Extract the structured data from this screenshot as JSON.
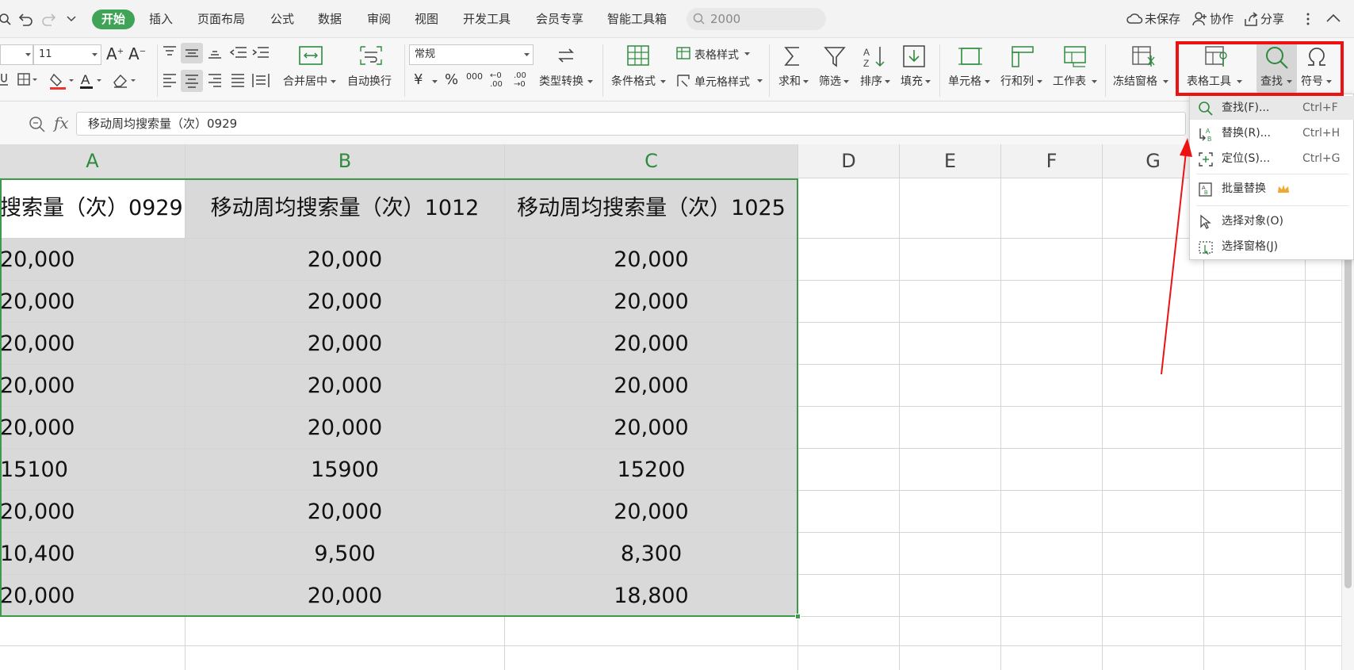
{
  "menubar": {
    "tabs": [
      "开始",
      "插入",
      "页面布局",
      "公式",
      "数据",
      "审阅",
      "视图",
      "开发工具",
      "会员专享",
      "智能工具箱"
    ],
    "active_tab": "开始",
    "search_value": "2000",
    "unsaved_label": "未保存",
    "collab_label": "协作",
    "share_label": "分享"
  },
  "ribbon": {
    "font_size": "11",
    "number_format": "常规",
    "merge_label": "合并居中",
    "wrap_label": "自动换行",
    "type_convert_label": "类型转换",
    "cond_format_label": "条件格式",
    "table_style_label": "表格样式",
    "cell_style_label": "单元格样式",
    "sum_label": "求和",
    "filter_label": "筛选",
    "sort_label": "排序",
    "fill_label": "填充",
    "cell_label": "单元格",
    "rowcol_label": "行和列",
    "sheet_label": "工作表",
    "freeze_label": "冻结窗格",
    "table_tools_label": "表格工具",
    "find_label": "查找",
    "symbol_label": "符号",
    "currency_symbol": "¥",
    "percent_symbol": "%",
    "thousands_symbol": "000",
    "dec_inc_symbol": "←0 .00",
    "dec_dec_symbol": ".00 →0"
  },
  "formula": {
    "fx_label": "fx",
    "content": "移动周均搜索量（次）0929"
  },
  "columns": [
    "A",
    "B",
    "C",
    "D",
    "E",
    "F",
    "G"
  ],
  "header_row": [
    "搜索量（次）0929",
    "移动周均搜索量（次）1012",
    "移动周均搜索量（次）1025"
  ],
  "rows": [
    [
      "20,000",
      "20,000",
      "20,000"
    ],
    [
      "20,000",
      "20,000",
      "20,000"
    ],
    [
      "20,000",
      "20,000",
      "20,000"
    ],
    [
      "20,000",
      "20,000",
      "20,000"
    ],
    [
      "20,000",
      "20,000",
      "20,000"
    ],
    [
      "15100",
      "15900",
      "15200"
    ],
    [
      "20,000",
      "20,000",
      "20,000"
    ],
    [
      "10,400",
      "9,500",
      "8,300"
    ],
    [
      "20,000",
      "20,000",
      "18,800"
    ]
  ],
  "dropdown": {
    "items": [
      {
        "label": "查找(F)...",
        "shortcut": "Ctrl+F"
      },
      {
        "label": "替换(R)...",
        "shortcut": "Ctrl+H"
      },
      {
        "label": "定位(S)...",
        "shortcut": "Ctrl+G"
      },
      {
        "label": "批量替换",
        "shortcut": ""
      },
      {
        "label": "选择对象(O)",
        "shortcut": ""
      },
      {
        "label": "选择窗格(J)",
        "shortcut": ""
      }
    ]
  },
  "colors": {
    "accent_green": "#3fa457",
    "annotation_red": "#ee1111",
    "selection_green": "#3c9a4a"
  }
}
